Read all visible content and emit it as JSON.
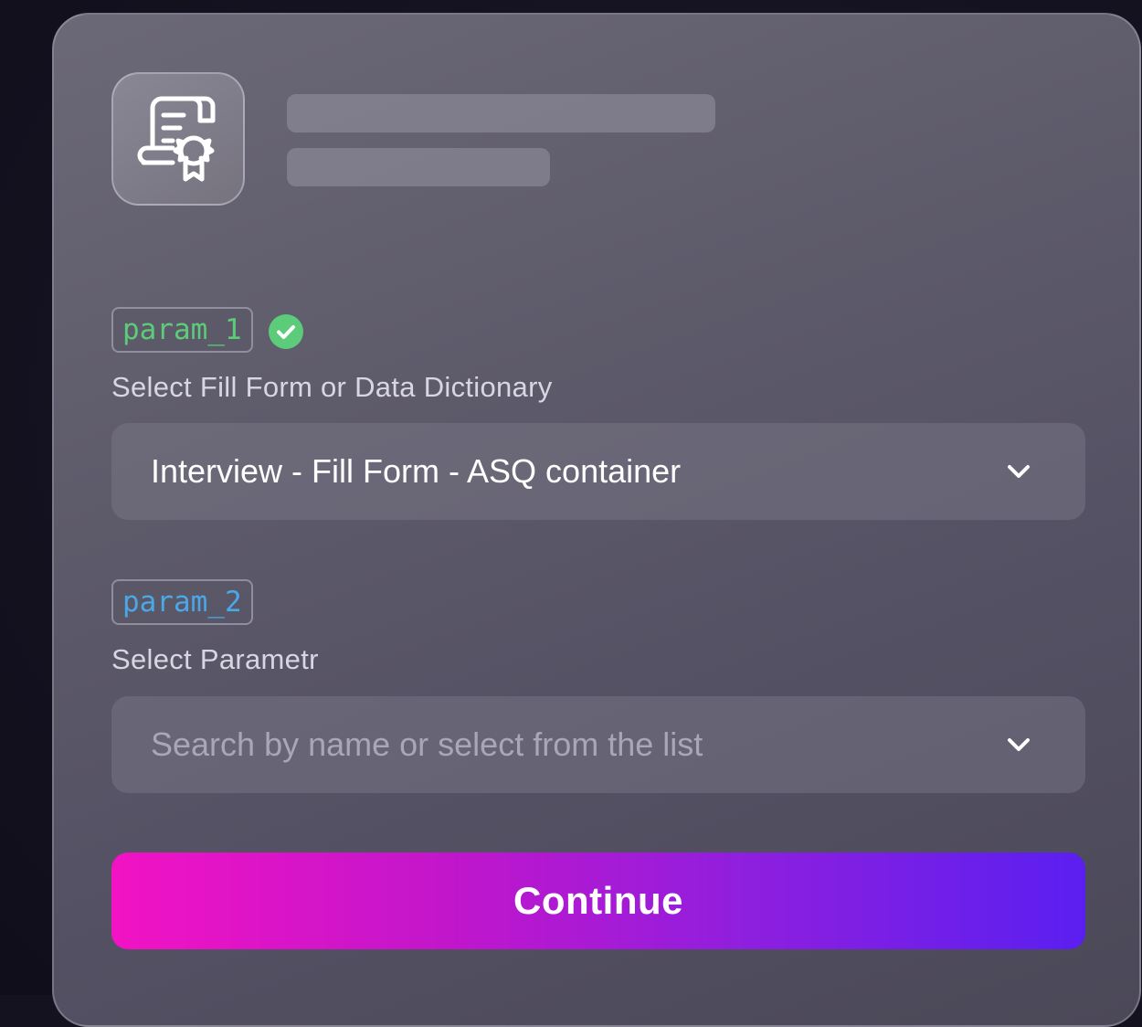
{
  "header": {
    "app_icon": "certificate-scroll-icon"
  },
  "params": [
    {
      "tag": "param_1",
      "tag_color": "#5dcc7a",
      "status_icon": "check-circle-icon",
      "status_color": "#5dcc7a",
      "label": "Select Fill Form or Data Dictionary",
      "value": "Interview - Fill Form - ASQ container"
    },
    {
      "tag": "param_2",
      "tag_color": "#4aa8e8",
      "label": "Select Parametr",
      "placeholder": "Search by name or select from the list"
    }
  ],
  "actions": {
    "continue_label": "Continue",
    "gradient": [
      "#f213c4",
      "#5a1ff0"
    ]
  }
}
